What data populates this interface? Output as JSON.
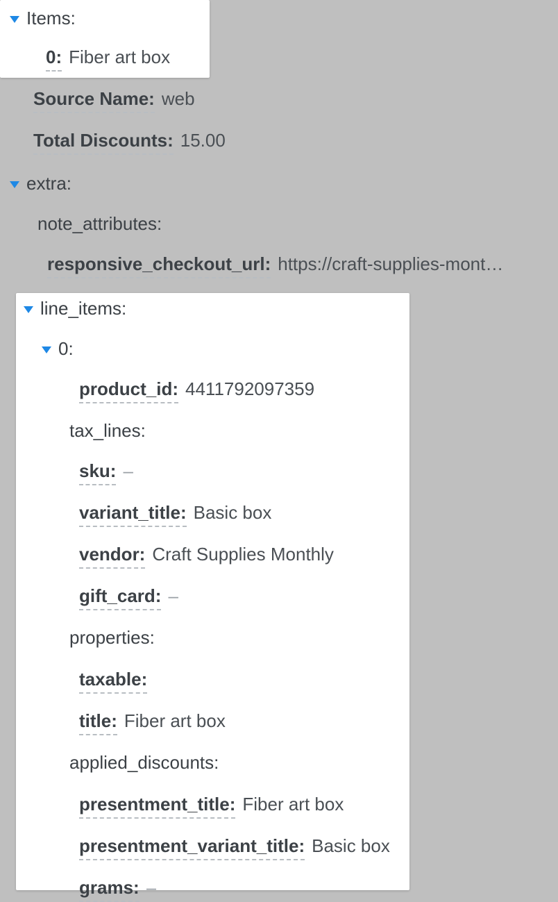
{
  "items": {
    "label": "Items:",
    "entries": [
      {
        "index": "0:",
        "value": "Fiber art box"
      }
    ]
  },
  "source_name": {
    "label": "Source Name:",
    "value": "web"
  },
  "total_discounts": {
    "label": "Total Discounts:",
    "value": "15.00"
  },
  "extra": {
    "label": "extra:",
    "note_attributes": {
      "label": "note_attributes:"
    },
    "responsive_checkout_url": {
      "label": "responsive_checkout_url:",
      "value": "https://craft-supplies-mont…"
    },
    "line_items": {
      "label": "line_items:",
      "entries": [
        {
          "index": "0:",
          "product_id": {
            "label": "product_id:",
            "value": "4411792097359"
          },
          "tax_lines": {
            "label": "tax_lines:"
          },
          "sku": {
            "label": "sku:",
            "value": "–"
          },
          "variant_title": {
            "label": "variant_title:",
            "value": "Basic box"
          },
          "vendor": {
            "label": "vendor:",
            "value": "Craft Supplies Monthly"
          },
          "gift_card": {
            "label": "gift_card:",
            "value": "–"
          },
          "properties": {
            "label": "properties:"
          },
          "taxable": {
            "label": "taxable:"
          },
          "title": {
            "label": "title:",
            "value": "Fiber art box"
          },
          "applied_discounts": {
            "label": "applied_discounts:"
          },
          "presentment_title": {
            "label": "presentment_title:",
            "value": "Fiber art box"
          },
          "presentment_variant_title": {
            "label": "presentment_variant_title:",
            "value": "Basic box"
          },
          "grams": {
            "label": "grams:",
            "value": "–"
          }
        }
      ]
    }
  }
}
